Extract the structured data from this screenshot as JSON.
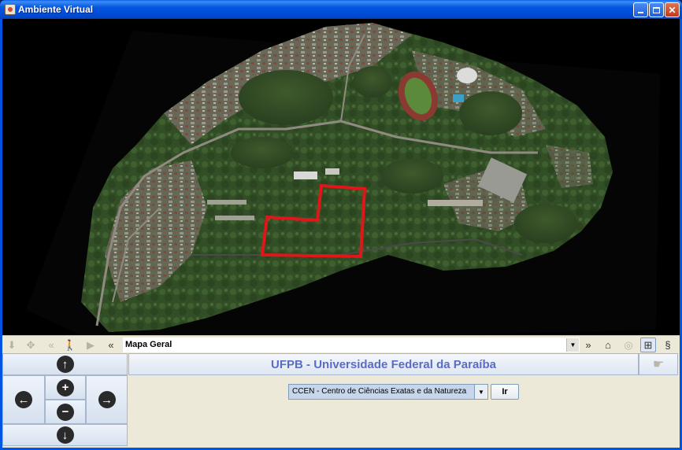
{
  "window": {
    "title": "Ambiente Virtual",
    "minimize_icon": "minimize-icon",
    "maximize_icon": "maximize-icon",
    "close_icon": "close-icon"
  },
  "toolbar": {
    "location_value": "Mapa Geral",
    "icons": [
      "arrow-down-icon",
      "move-icon",
      "back-icon",
      "walk-icon",
      "play-icon",
      "double-chevron-left-icon",
      "double-chevron-right-icon",
      "home-icon",
      "binoculars-icon",
      "fit-view-icon",
      "switch-icon"
    ]
  },
  "panel": {
    "title": "UFPB - Universidade Federal da Paraíba",
    "selected_center": "CCEN - Centro de Ciências Exatas e da Natureza",
    "go_label": "Ir"
  },
  "colors": {
    "title_blue": "#5a6cc4",
    "highlight_red": "#e0161a"
  }
}
